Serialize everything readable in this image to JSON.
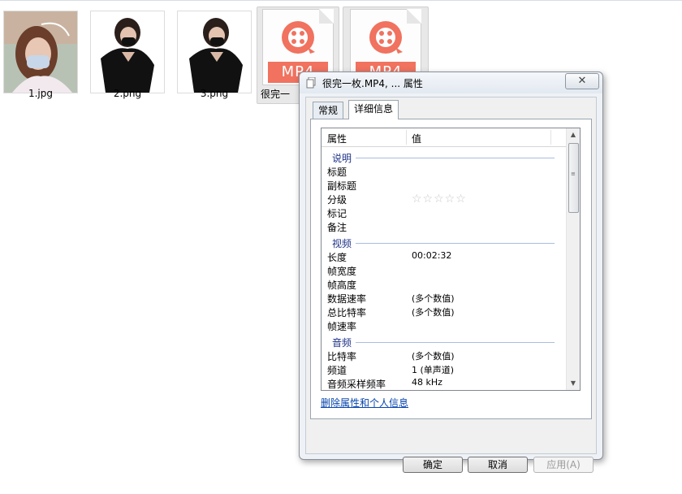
{
  "files": [
    {
      "name": "1.jpg"
    },
    {
      "name": "2.png"
    },
    {
      "name": "3.png"
    },
    {
      "name": "很完一",
      "icon_label": "MP4"
    },
    {
      "name": "",
      "icon_label": "MP4"
    }
  ],
  "dialog": {
    "title": "很完一枚.MP4, ... 属性",
    "close_symbol": "✕",
    "tabs": [
      "常规",
      "详细信息"
    ],
    "active_tab": "详细信息",
    "columns": {
      "property": "属性",
      "value": "值"
    },
    "groups": [
      {
        "label": "说明",
        "rows": [
          {
            "k": "标题",
            "v": ""
          },
          {
            "k": "副标题",
            "v": ""
          },
          {
            "k": "分级",
            "v": "",
            "stars": "☆☆☆☆☆"
          },
          {
            "k": "标记",
            "v": ""
          },
          {
            "k": "备注",
            "v": ""
          }
        ]
      },
      {
        "label": "视频",
        "rows": [
          {
            "k": "长度",
            "v": "00:02:32"
          },
          {
            "k": "帧宽度",
            "v": ""
          },
          {
            "k": "帧高度",
            "v": ""
          },
          {
            "k": "数据速率",
            "v": "(多个数值)"
          },
          {
            "k": "总比特率",
            "v": "(多个数值)"
          },
          {
            "k": "帧速率",
            "v": ""
          }
        ]
      },
      {
        "label": "音频",
        "rows": [
          {
            "k": "比特率",
            "v": "(多个数值)"
          },
          {
            "k": "频道",
            "v": "1 (单声道)"
          },
          {
            "k": "音频采样频率",
            "v": "48 kHz"
          }
        ]
      }
    ],
    "remove_link": "删除属性和个人信息",
    "buttons": {
      "ok": "确定",
      "cancel": "取消",
      "apply": "应用(A)"
    },
    "colors": {
      "group_header": "#1e3287",
      "link": "#0645ad",
      "mp4_band": "#f0725f"
    }
  }
}
